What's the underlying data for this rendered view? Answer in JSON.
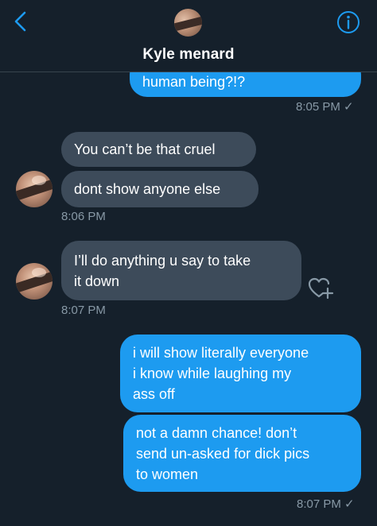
{
  "header": {
    "title": "Kyle menard",
    "back_icon": "chevron-left-icon",
    "info_icon": "info-circle-icon",
    "accent_color": "#1d9bf0"
  },
  "messages": [
    {
      "id": "m1",
      "direction": "outgoing",
      "text": "human being?!?"
    },
    {
      "id": "m2",
      "direction": "incoming",
      "text": "You can’t be that cruel"
    },
    {
      "id": "m3",
      "direction": "incoming",
      "text": "dont show anyone else"
    },
    {
      "id": "m4",
      "direction": "incoming",
      "text": "I’ll do anything u say to take\nit down"
    },
    {
      "id": "m5",
      "direction": "outgoing",
      "text": "i will show literally everyone\ni know while laughing my\nass off"
    },
    {
      "id": "m6",
      "direction": "outgoing",
      "text": "not a damn chance! don’t\nsend un-asked for dick pics\nto women"
    }
  ],
  "timestamps": {
    "t1": "8:05 PM ✓",
    "t2": "8:06 PM",
    "t3": "8:07 PM",
    "t4": "8:07 PM ✓"
  },
  "icons": {
    "react": "heart-plus-icon"
  },
  "colors": {
    "background": "#15202b",
    "outgoing_bubble": "#1d9bf0",
    "incoming_bubble": "#3d4b5a",
    "meta_text": "#8899a6"
  }
}
